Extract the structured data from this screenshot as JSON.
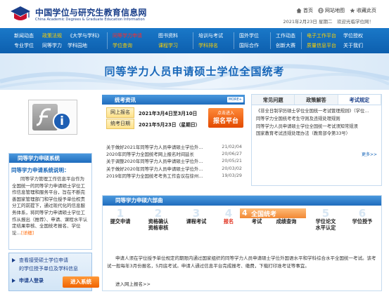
{
  "header": {
    "site_name": "中国学位与研究生教育信息网",
    "site_name_en": "China Academic Degrees & Graduate Education Information",
    "links": [
      "首页",
      "网站地图",
      "收藏此页"
    ],
    "date_line": "2021年2月23日 星期二　欢迎光临学位网！"
  },
  "nav": {
    "columns": [
      [
        "新闻动态",
        "专业学位"
      ],
      [
        "政策法规",
        "同等学力"
      ],
      [
        "《大学与学科》",
        "学科园地"
      ],
      [
        "同等学力申请",
        "学位查询"
      ],
      [
        "图书资料",
        "课程学习"
      ],
      [
        "培训与考试",
        "学科排名"
      ],
      [
        "国外学位",
        "国际合作"
      ],
      [
        "工作动态",
        "创新大赛"
      ],
      [
        "电子工作平台",
        "质量信息平台"
      ],
      [
        "学位授权",
        "关于我们"
      ]
    ],
    "highlight": {
      "1.0": "hl",
      "3.0": "hl-red",
      "3.1": "hl",
      "4.1": "hl",
      "5.1": "hl",
      "8.0": "hl",
      "8.1": "hl"
    }
  },
  "banner": {
    "title": "同等学力人员申请硕士学位全国统考"
  },
  "flash": {
    "icon": "flash-plugin-missing-icon"
  },
  "left_panel": {
    "header": "同等学力申硕系统",
    "title": "同等学力申请系统说明：",
    "text": "同等学力管理工作信息平台作为全国统一的同等学力申请硕士学位工作信息管理和服务平台，旨在不断完善国家管理部门和学位授予单位权责分工的前提下，通过现代化的信息服务体系，将同等学力申请硕士学位工作从报出（推荐）、申请、课程水平认定结果审核、全国统考报名、学位论…",
    "more": "[详细]"
  },
  "register_box": {
    "line1": "查看接受硕士学位申请",
    "line2": "的学位授予单位及学科信息",
    "line3": "申请人登录",
    "button": "进入系统"
  },
  "exam_info": {
    "header": "统考资讯",
    "more": "MORE+",
    "register_open_label": "网上报名",
    "register_open_value": "2021年3月4日至3月10日",
    "exam_date_label": "统考日期",
    "exam_date_value": "2021年5月23日（星期日）",
    "platform_sub": "点击进入",
    "platform_main": "报名平台",
    "news": [
      {
        "title": "关于做好2021年同等学力人员申请硕士学位外…",
        "date": "21/02/04"
      },
      {
        "title": "2020年同等学力全国统考网上报名时间延长",
        "date": "20/06/27"
      },
      {
        "title": "关于调整2020年同等学力人员申请硕士学位外…",
        "date": "20/05/21"
      },
      {
        "title": "关于做好2020年同等学力人员申请硕士学位外…",
        "date": "20/03/02"
      },
      {
        "title": "2019年同等学力全国统考考务工作会议在徐州…",
        "date": "19/03/29"
      }
    ]
  },
  "tabs": {
    "labels": [
      "常见问题",
      "政策解答",
      "考试规定"
    ],
    "active": 2,
    "items": [
      "《非全日制学历硕士学位全国统一考试管理规则》（学位…",
      "同等学力全国统考考生守则及违规处理规则",
      "同等学力人员申请硕士学位全国统一考试须知常规须",
      "国家教育考试违规处理办法（教育部令第33号）"
    ],
    "more": "更多>>"
  },
  "process": {
    "header": "同等学力申硕六部曲",
    "steps": [
      {
        "num": "1",
        "label": "提交申请"
      },
      {
        "num": "2",
        "label": "资格确认"
      },
      {
        "num": "3",
        "label": "课程考试"
      },
      {
        "num": "4",
        "label": "报名"
      },
      {
        "num": "",
        "label": "考试"
      },
      {
        "num": "",
        "label": "成绩查询"
      },
      {
        "num": "5",
        "label": "学位论文"
      },
      {
        "num": "6",
        "label": "学位授予"
      }
    ],
    "sublabels": [
      "",
      "资格审核",
      "",
      "",
      "",
      "",
      "水平认定",
      ""
    ],
    "current_step_title": "全国统考",
    "current_step_num": "4",
    "body": "申请人须在学位授予单位规定的期限内通过国家组织的同等学力人员申请硕士学位外国语水平和学科综合水平全国统一考试。该考试一般每年3月份报名，5月底考试。申请人通过信息平台完成报考、缴费，下载打印准考证等事宜。",
    "link": "进入网上报名>>"
  }
}
